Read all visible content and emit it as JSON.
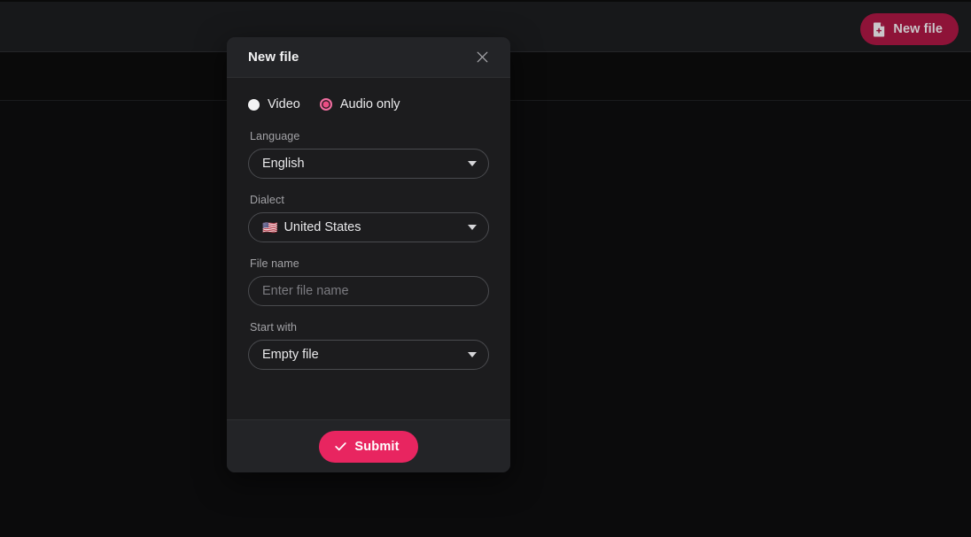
{
  "app": {
    "background_color": "#0a0a0a",
    "accent_color": "#e82560",
    "topbar": {
      "new_file_button": {
        "label": "New file",
        "icon": "file-plus-icon",
        "color": "#8e1338"
      }
    }
  },
  "modal": {
    "title": "New file",
    "close_icon": "close-icon",
    "mode_options": [
      {
        "label": "Video",
        "selected": false,
        "icon": "radio-unselected-icon"
      },
      {
        "label": "Audio only",
        "selected": true,
        "icon": "radio-selected-icon"
      }
    ],
    "fields": [
      {
        "name": "language",
        "label": "Language",
        "type": "select",
        "value": "English",
        "flag": "",
        "caret_icon": "chevron-down-icon"
      },
      {
        "name": "dialect",
        "label": "Dialect",
        "type": "select",
        "value": "United States",
        "flag": "🇺🇸",
        "caret_icon": "chevron-down-icon"
      },
      {
        "name": "file-name",
        "label": "File name",
        "type": "text",
        "value": "",
        "placeholder": "Enter file name",
        "flag": "",
        "caret_icon": ""
      },
      {
        "name": "start-with",
        "label": "Start with",
        "type": "select",
        "value": "Empty file",
        "flag": "",
        "caret_icon": "chevron-down-icon"
      }
    ],
    "footer": {
      "submit_label": "Submit",
      "submit_icon": "check-icon"
    }
  }
}
